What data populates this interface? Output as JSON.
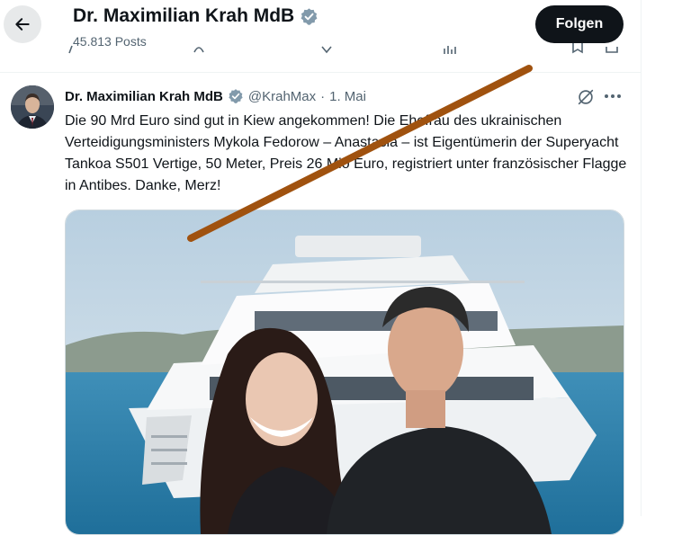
{
  "header": {
    "title": "Dr. Maximilian Krah MdB",
    "posts_count": "45.813 Posts",
    "follow_label": "Folgen"
  },
  "tweet": {
    "name": "Dr. Maximilian Krah MdB",
    "handle": "@KrahMax",
    "separator": "·",
    "date": "1. Mai",
    "text": "Die 90 Mrd Euro sind gut in Kiew angekommen! Die Ehefrau des ukrainischen Verteidigungsministers Mykola Fedorow – Anastasia – ist Eigentümerin der Superyacht Tankoa S501 Vertige, 50 Meter, Preis 26 Mio Euro, registriert unter französischer Flagge in Antibes. Danke, Merz!"
  },
  "colors": {
    "accent": "#1d9bf0",
    "verified_badge": "#829aab",
    "annotation_line": "#a0520f"
  },
  "icons": [
    "back-arrow-icon",
    "verified-badge-icon",
    "grok-icon",
    "more-icon"
  ]
}
